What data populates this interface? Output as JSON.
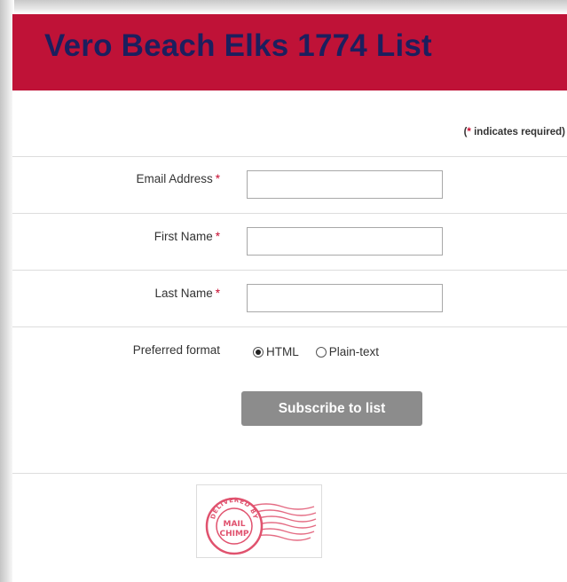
{
  "header": {
    "title": "Vero Beach Elks 1774 List"
  },
  "required_note": {
    "prefix": "(",
    "star": "*",
    "text": " indicates required)"
  },
  "fields": [
    {
      "label": "Email Address",
      "required_star": "*",
      "value": ""
    },
    {
      "label": "First Name",
      "required_star": "*",
      "value": ""
    },
    {
      "label": "Last Name",
      "required_star": "*",
      "value": ""
    }
  ],
  "format": {
    "label": "Preferred format",
    "options": [
      "HTML",
      "Plain-text"
    ],
    "selected": "HTML"
  },
  "subscribe_button": {
    "label": "Subscribe to list"
  },
  "badge": {
    "arc_text": "DELIVERED BY",
    "line1": "MAIL",
    "line2": "CHIMP",
    "color": "#e0526e"
  },
  "colors": {
    "header_bg": "#bf1237",
    "title": "#1c1f5e",
    "required_star": "#c60c30",
    "button_bg": "#8c8c8c"
  }
}
